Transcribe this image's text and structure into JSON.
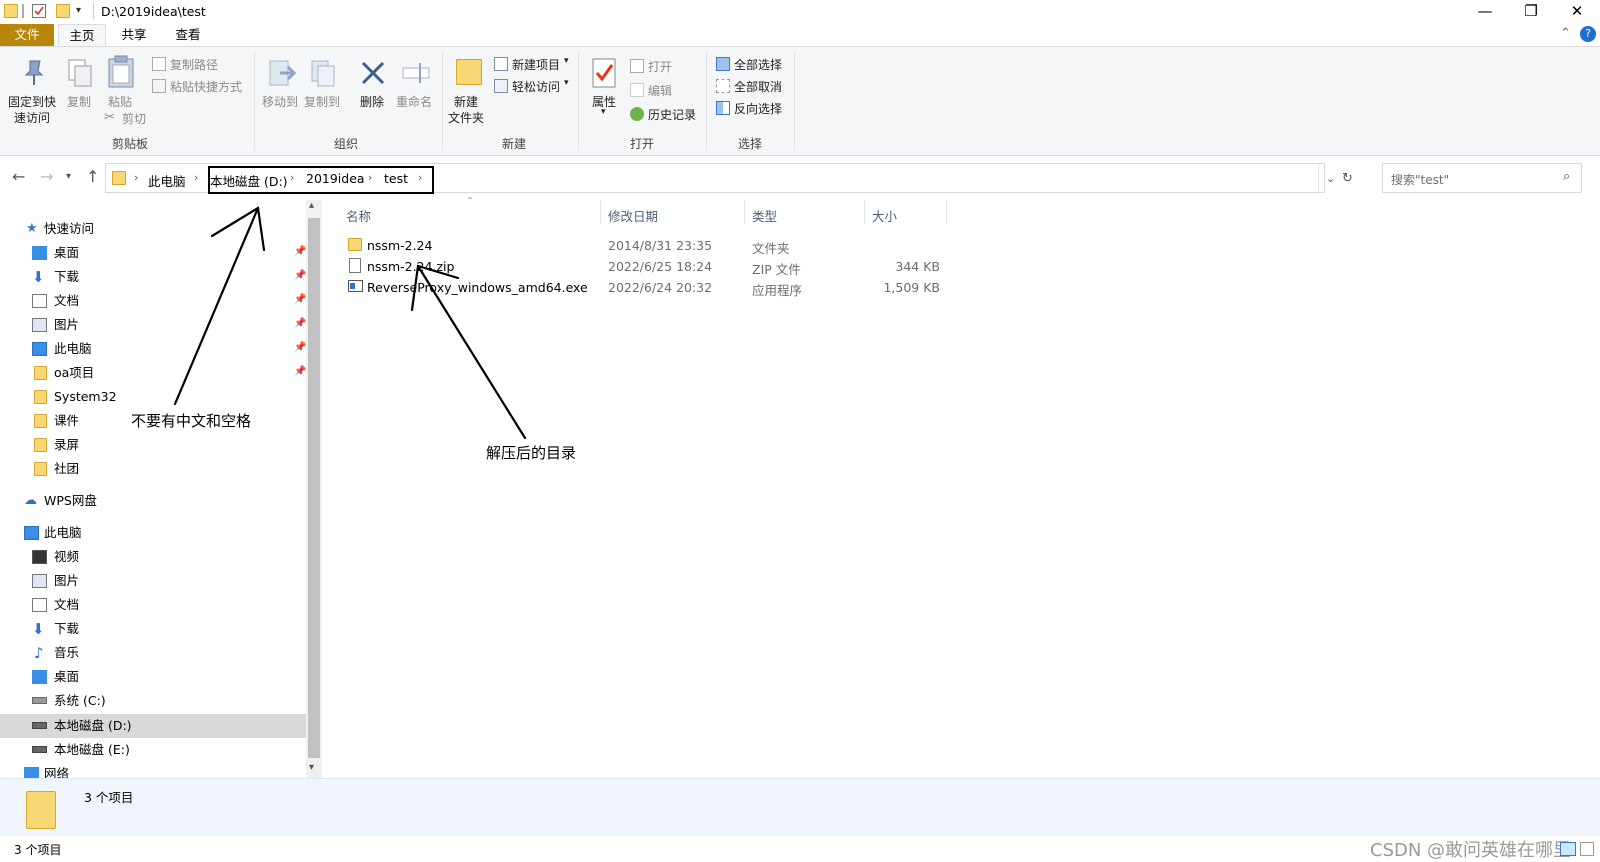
{
  "window": {
    "path": "D:\\2019idea\\test",
    "min": "—",
    "max": "❐",
    "close": "✕",
    "collapse": "⌃",
    "help": "?"
  },
  "tabs": [
    "文件",
    "主页",
    "共享",
    "查看"
  ],
  "ribbon": {
    "clipboard": {
      "pin_line1": "固定到快",
      "pin_line2": "速访问",
      "copy": "复制",
      "paste": "粘贴",
      "copy_path": "复制路径",
      "paste_shortcut": "粘贴快捷方式",
      "cut": "剪切",
      "group": "剪贴板"
    },
    "organize": {
      "move_to": "移动到",
      "copy_to": "复制到",
      "delete": "删除",
      "rename": "重命名",
      "group": "组织"
    },
    "new": {
      "new_folder_line1": "新建",
      "new_folder_line2": "文件夹",
      "new_item": "新建项目",
      "easy_access": "轻松访问",
      "group": "新建"
    },
    "open": {
      "properties": "属性",
      "open": "打开",
      "edit": "编辑",
      "history": "历史记录",
      "group": "打开"
    },
    "select": {
      "select_all": "全部选择",
      "select_none": "全部取消",
      "invert": "反向选择",
      "group": "选择"
    }
  },
  "address": {
    "crumbs": [
      "此电脑",
      "本地磁盘 (D:)",
      "2019idea",
      "test"
    ],
    "search_placeholder": "搜索\"test\""
  },
  "nav": {
    "quick_access": "快速访问",
    "quick_items": [
      "桌面",
      "下载",
      "文档",
      "图片",
      "此电脑",
      "oa项目",
      "System32",
      "课件",
      "录屏",
      "社团"
    ],
    "wps": "WPS网盘",
    "this_pc": "此电脑",
    "pc_items": [
      "视频",
      "图片",
      "文档",
      "下载",
      "音乐",
      "桌面",
      "系统 (C:)",
      "本地磁盘 (D:)",
      "本地磁盘 (E:)"
    ],
    "network": "网络"
  },
  "columns": {
    "name": "名称",
    "modified": "修改日期",
    "type": "类型",
    "size": "大小"
  },
  "files": [
    {
      "name": "nssm-2.24",
      "modified": "2014/8/31 23:35",
      "type": "文件夹",
      "size": ""
    },
    {
      "name": "nssm-2.24.zip",
      "modified": "2022/6/25 18:24",
      "type": "ZIP 文件",
      "size": "344 KB"
    },
    {
      "name": "ReverseProxy_windows_amd64.exe",
      "modified": "2022/6/24 20:32",
      "type": "应用程序",
      "size": "1,509 KB"
    }
  ],
  "details": {
    "count": "3 个项目"
  },
  "status": {
    "count": "3 个项目"
  },
  "annotations": {
    "left": "不要有中文和空格",
    "right": "解压后的目录"
  },
  "watermark": "CSDN @敢问英雄在哪里",
  "colors": {
    "file_tab": "#b8860b",
    "folder": "#f8d775",
    "selection": "#cce8ff",
    "nav_selected": "#d9d9d9"
  }
}
